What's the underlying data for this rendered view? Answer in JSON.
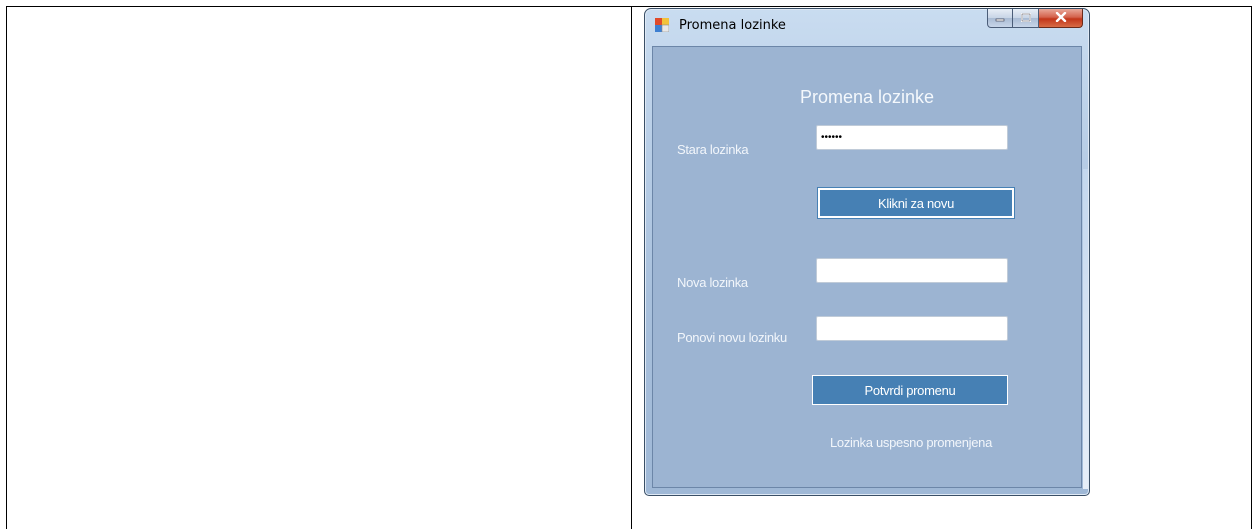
{
  "window": {
    "title": "Promena lozinke"
  },
  "form": {
    "heading": "Promena lozinke",
    "old_password": {
      "label": "Stara lozinka",
      "value": "••••••"
    },
    "new_button_label": "Klikni za novu",
    "new_password": {
      "label": "Nova lozinka",
      "value": ""
    },
    "repeat_password": {
      "label": "Ponovi novu lozinku",
      "value": ""
    },
    "confirm_button_label": "Potvrdi promenu",
    "status_message": "Lozinka uspesno promenjena"
  },
  "colors": {
    "form_background": "#9cb4d2",
    "button_background": "#4680b4",
    "close_button": "#c2361a"
  },
  "icons": {
    "app": "app-icon",
    "minimize": "minimize-icon",
    "maximize": "maximize-icon",
    "close": "close-icon"
  }
}
